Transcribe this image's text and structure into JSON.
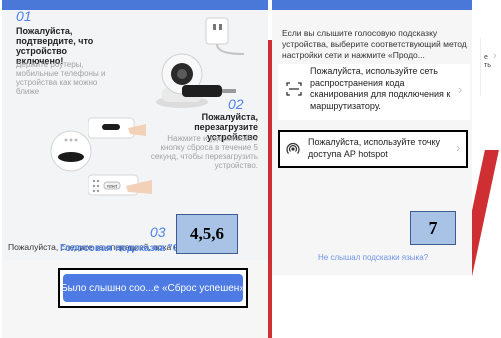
{
  "left": {
    "step1": {
      "number": "01",
      "title": "Пожалуйста, подтвердите, что устройство включено!",
      "desc": "Держите роутеры, мобильные телефоны и устройства как можно ближе"
    },
    "step2": {
      "number": "02",
      "title": "Пожалуйста, перезагрузите устройство",
      "desc": "Нажмите и удерживайте кнопку сброса в течение 5 секунд, чтобы перезагрузить устройство."
    },
    "step3": {
      "number": "03",
      "text_prefix": "Пожалуйста, следите за операцией, пока не",
      "voice_link": "Голосовая подсказка \"Сб",
      "reset_label": "reset"
    },
    "annotation": "4,5,6",
    "confirm_button": "Было слышно соо...е «Сброс успешен»"
  },
  "right": {
    "intro": "Если вы слышите голосовую подсказку устройства, выберите соответствующий метод настройки сети и нажмите «Продо...",
    "option_qr": "Пожалуйста, используйте сеть распространения кода сканирования для подключения к маршрутизатору.",
    "option_ap": "Пожалуйста, используйте точку доступа AP hotspot",
    "annotation": "7",
    "no_prompt": "Не слышал подсказки языка?"
  },
  "edge": {
    "text": "е\nть"
  },
  "colors": {
    "accent_blue": "#4d82ee",
    "topbar_blue": "#4a78d8",
    "button_blue": "#4d7ae3",
    "red_shape": "#cf2e32",
    "label_box_fill": "#a9c3e6"
  }
}
